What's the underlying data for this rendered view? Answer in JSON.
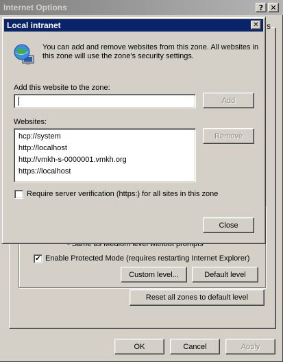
{
  "parent_window": {
    "title": "Internet Options",
    "help_btn": "?",
    "close_btn": "✕",
    "tab_fragment": "s",
    "zone_hint": "- Same as Medium level without prompts",
    "protected_mode_label": "Enable Protected Mode (requires restarting Internet Explorer)",
    "protected_mode_checked": "✔",
    "custom_level_button": "Custom level...",
    "default_level_button": "Default level",
    "reset_zones_button": "Reset all zones to default level",
    "ok_button": "OK",
    "cancel_button": "Cancel",
    "apply_button": "Apply"
  },
  "dialog": {
    "title": "Local intranet",
    "close_btn": "✕",
    "description": "You can add and remove websites from this zone. All websites in this zone will use the zone's security settings.",
    "add_label": "Add this website to the zone:",
    "add_input_value": "",
    "add_button": "Add",
    "websites_label": "Websites:",
    "websites": [
      "hcp://system",
      "http://localhost",
      "http://vmkh-s-0000001.vmkh.org",
      "https://localhost"
    ],
    "remove_button": "Remove",
    "require_https_label": "Require server verification (https:) for all sites in this zone",
    "require_https_checked": "",
    "close_button": "Close"
  },
  "colors": {
    "dialog_title_bg": "#0a246a",
    "inactive_title_bg": "#808080",
    "face": "#d4d0c8"
  }
}
